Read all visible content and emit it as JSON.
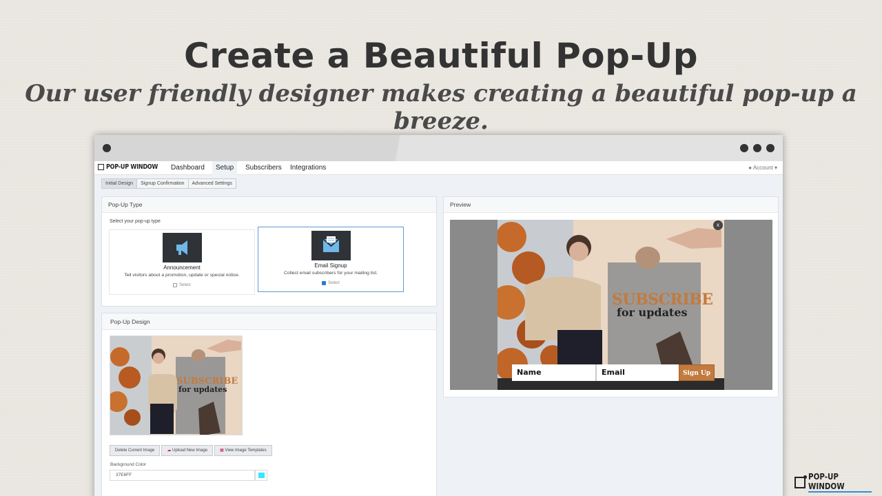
{
  "hero": {
    "title": "Create a Beautiful Pop-Up",
    "subtitle": "Our user friendly designer makes creating a beautiful pop-up a breeze."
  },
  "app": {
    "logo_text": "POP-UP WINDOW",
    "nav": [
      "Dashboard",
      "Setup",
      "Subscribers",
      "Integrations"
    ],
    "active_nav": "Setup",
    "account_label": "Account",
    "subtabs": [
      "Initial Design",
      "Signup Confirmation",
      "Advanced Settings"
    ],
    "active_subtab": "Initial Design"
  },
  "popup_type": {
    "title": "Pop-Up Type",
    "hint": "Select your pop-up type",
    "options": [
      {
        "name": "Announcement",
        "description": "Tell visitors about a promotion, update or special notice.",
        "select_label": "Select",
        "selected": false,
        "icon": "megaphone-icon"
      },
      {
        "name": "Email Signup",
        "description": "Collect email subscribers for your mailing list.",
        "select_label": "Select",
        "selected": true,
        "icon": "envelope-icon"
      }
    ]
  },
  "popup_design": {
    "title": "Pop-Up Design",
    "buttons": [
      "Delete Current Image",
      "Upload New Image",
      "View Image Templates"
    ],
    "background_color_label": "Background Color",
    "background_color_value": "37E6FF",
    "swatch_color": "#37e6ff"
  },
  "preview": {
    "title": "Preview",
    "headline": "SUBSCRIBE",
    "subheadline": "for updates",
    "name_placeholder": "Name",
    "email_placeholder": "Email",
    "signup_label": "Sign Up",
    "close_label": "x"
  },
  "footer_brand": "POP-UP WINDOW",
  "colors": {
    "accent": "#c27a3e",
    "selected_border": "#5b9bd5"
  }
}
